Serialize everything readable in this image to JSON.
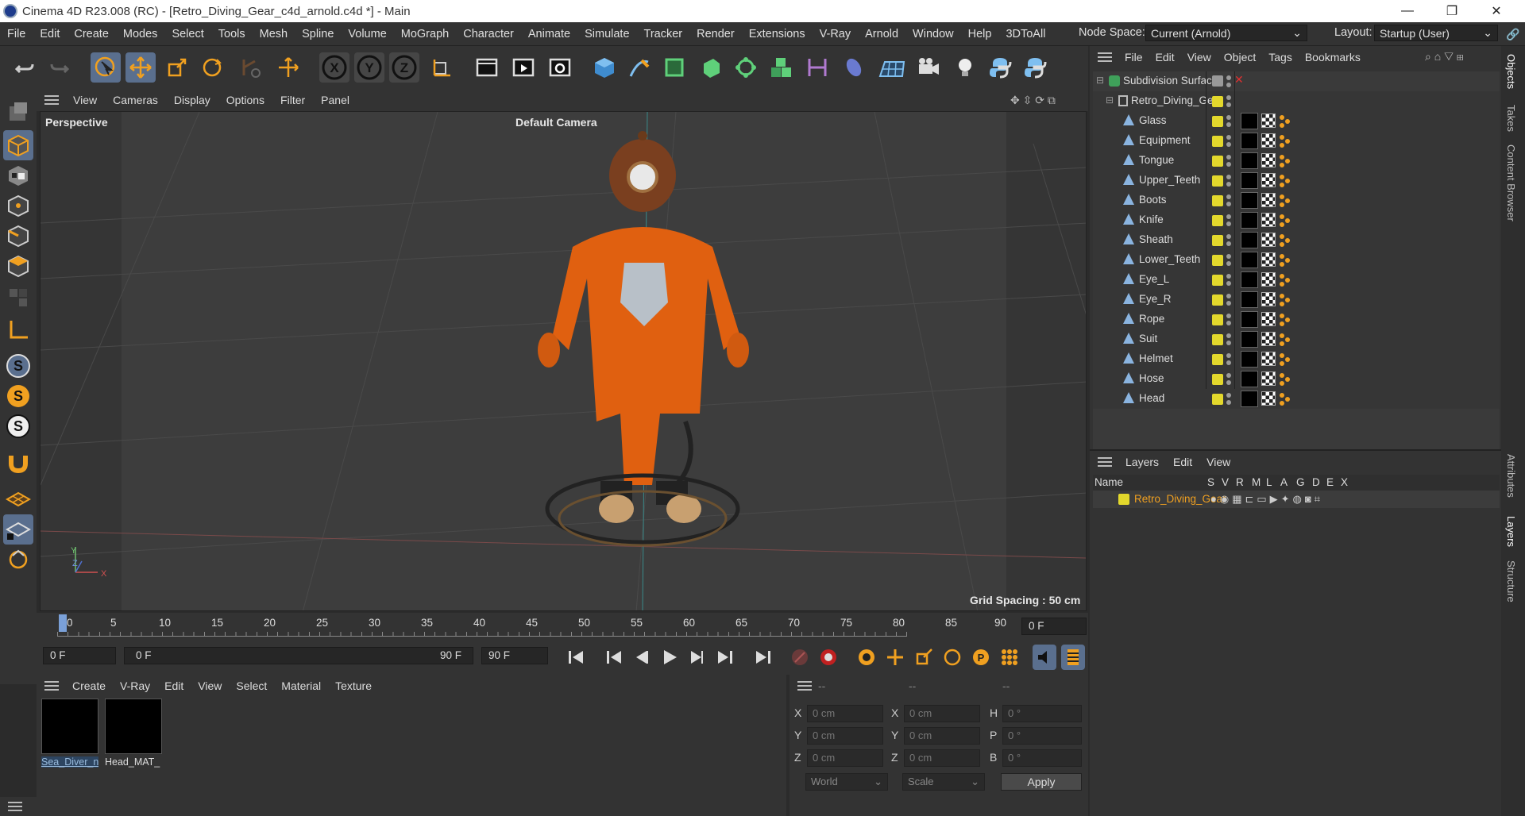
{
  "window": {
    "title": "Cinema 4D R23.008 (RC) - [Retro_Diving_Gear_c4d_arnold.c4d *] - Main",
    "controls": [
      "—",
      "❐",
      "✕"
    ]
  },
  "menubar": {
    "items": [
      "File",
      "Edit",
      "Create",
      "Modes",
      "Select",
      "Tools",
      "Mesh",
      "Spline",
      "Volume",
      "MoGraph",
      "Character",
      "Animate",
      "Simulate",
      "Tracker",
      "Render",
      "Extensions",
      "V-Ray",
      "Arnold",
      "Window",
      "Help",
      "3DToAll"
    ],
    "node_space_label": "Node Space:",
    "node_space_value": "Current (Arnold)",
    "layout_label": "Layout:",
    "layout_value": "Startup (User)"
  },
  "toolbar": {
    "axis_labels": [
      "X",
      "Y",
      "Z"
    ]
  },
  "viewport": {
    "menu": [
      "View",
      "Cameras",
      "Display",
      "Options",
      "Filter",
      "Panel"
    ],
    "view_name": "Perspective",
    "camera_name": "Default Camera",
    "grid_spacing": "Grid Spacing : 50 cm",
    "axis_x": "X",
    "axis_y": "Y",
    "axis_z": "Z"
  },
  "timeline": {
    "ticks": [
      "0",
      "5",
      "10",
      "15",
      "20",
      "25",
      "30",
      "35",
      "40",
      "45",
      "50",
      "55",
      "60",
      "65",
      "70",
      "75",
      "80",
      "85",
      "90"
    ],
    "current_frame": "0 F"
  },
  "anim": {
    "start": "0 F",
    "range_start": "0 F",
    "range_end": "90 F",
    "end": "90 F"
  },
  "materials": {
    "menu": [
      "Create",
      "V-Ray",
      "Edit",
      "View",
      "Select",
      "Material",
      "Texture"
    ],
    "items": [
      {
        "name": "Sea_Diver_n",
        "selected": true
      },
      {
        "name": "Head_MAT_",
        "selected": false
      }
    ]
  },
  "coords": {
    "headers": [
      "--",
      "--",
      "--"
    ],
    "rows": [
      {
        "a": "X",
        "v1": "0 cm",
        "b": "X",
        "v2": "0 cm",
        "c": "H",
        "v3": "0 °"
      },
      {
        "a": "Y",
        "v1": "0 cm",
        "b": "Y",
        "v2": "0 cm",
        "c": "P",
        "v3": "0 °"
      },
      {
        "a": "Z",
        "v1": "0 cm",
        "b": "Z",
        "v2": "0 cm",
        "c": "B",
        "v3": "0 °"
      }
    ],
    "space": "World",
    "mode": "Scale",
    "apply": "Apply"
  },
  "objects": {
    "menu": [
      "File",
      "Edit",
      "View",
      "Object",
      "Tags",
      "Bookmarks"
    ],
    "root": "Subdivision Surface",
    "group": "Retro_Diving_Gear",
    "children": [
      "Glass",
      "Equipment",
      "Tongue",
      "Upper_Teeth",
      "Boots",
      "Knife",
      "Sheath",
      "Lower_Teeth",
      "Eye_L",
      "Eye_R",
      "Rope",
      "Suit",
      "Helmet",
      "Hose",
      "Head"
    ]
  },
  "layers": {
    "menu": [
      "Layers",
      "Edit",
      "View"
    ],
    "columns": [
      "Name",
      "S",
      "V",
      "R",
      "M",
      "L",
      "A",
      "G",
      "D",
      "E",
      "X"
    ],
    "rows": [
      {
        "name": "Retro_Diving_Gear"
      }
    ]
  },
  "sidetabs": [
    "Objects",
    "Takes",
    "Content Browser",
    "Attributes",
    "Layers",
    "Structure"
  ],
  "colors": {
    "accent": "#5a6f8e",
    "layer_name": "#f0a020",
    "object_yellow": "#e3d82c"
  }
}
